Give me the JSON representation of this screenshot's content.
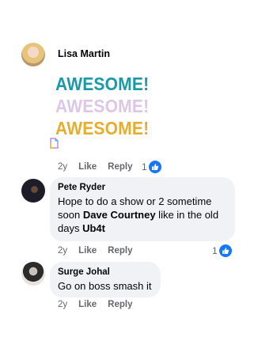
{
  "comments": [
    {
      "author": "Lisa Martin",
      "sticker_lines": [
        "AWESOME!",
        "AWESOME!",
        "AWESOME!"
      ],
      "age": "2y",
      "like_label": "Like",
      "reply_label": "Reply",
      "reaction_count": "1"
    },
    {
      "author": "Pete Ryder",
      "text_parts": [
        "Hope to do a show or 2 sometime soon ",
        "Dave Courtney",
        " like in the old days ",
        "Ub4t"
      ],
      "age": "2y",
      "like_label": "Like",
      "reply_label": "Reply",
      "reaction_count": "1"
    },
    {
      "author": "Surge Johal",
      "text": "Go on boss smash it",
      "age": "2y",
      "like_label": "Like",
      "reply_label": "Reply"
    }
  ],
  "colors": {
    "like_blue": "#1877f2",
    "bubble_bg": "#f0f2f5",
    "meta_gray": "#65676b",
    "sticker_teal": "#1a9aa8",
    "sticker_lilac": "#dcc8e4",
    "sticker_gold": "#e6ad2e"
  },
  "icons": [
    "like-icon",
    "document-icon"
  ]
}
